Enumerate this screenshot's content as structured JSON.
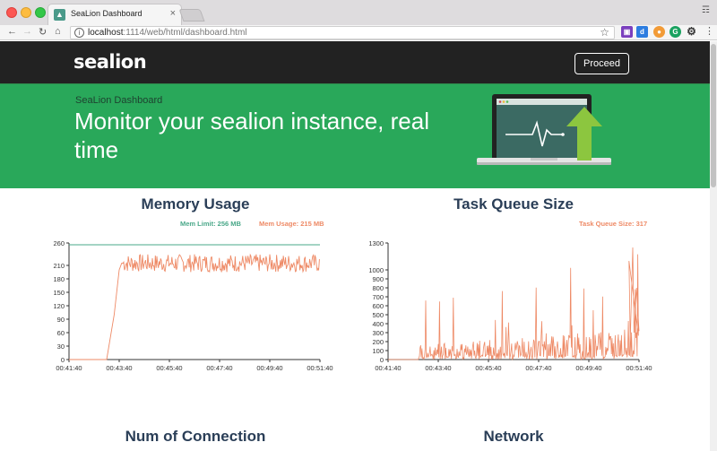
{
  "browser": {
    "tab_title": "SeaLion Dashboard",
    "tab_close": "×",
    "tab_favicon": "🐾",
    "url_host": "localhost",
    "url_path": ":1114/web/html/dashboard.html",
    "icons": [
      "back-icon",
      "forward-icon",
      "reload-icon",
      "home-icon",
      "info-icon",
      "star-icon",
      "menu-icon"
    ]
  },
  "navbar": {
    "logo": "sealion",
    "proceed_label": "Proceed"
  },
  "hero": {
    "subtitle": "SeaLion Dashboard",
    "title": "Monitor your sealion instance, real time"
  },
  "colors": {
    "navbar_bg": "#222222",
    "hero_bg": "#29a85a",
    "limit_series": "#4aa889",
    "usage_series": "#ee8a66",
    "title_text": "#2a3e57"
  },
  "sections": {
    "memory_title": "Memory Usage",
    "queue_title": "Task Queue Size",
    "connection_title": "Num of Connection",
    "network_title": "Network"
  },
  "chart_data": [
    {
      "type": "line",
      "title": "Memory Usage",
      "legend": [
        "Mem Limit: 256 MB",
        "Mem Usage: 215 MB"
      ],
      "x_ticks": [
        "00:41:40",
        "00:43:40",
        "00:45:40",
        "00:47:40",
        "00:49:40",
        "00:51:40"
      ],
      "y_ticks": [
        0,
        30,
        60,
        90,
        120,
        150,
        180,
        210,
        260
      ],
      "ylim": [
        0,
        260
      ],
      "series": [
        {
          "name": "Mem Limit: 256 MB",
          "color": "#4aa889",
          "values": [
            256,
            256
          ]
        },
        {
          "name": "Mem Usage: 215 MB",
          "color": "#ee8a66",
          "x_minutes": [
            0,
            1.2,
            1.5,
            1.8,
            2.0,
            2.1,
            10
          ],
          "values": [
            0,
            0,
            0,
            100,
            200,
            215,
            215
          ],
          "noise_range": [
            195,
            235
          ]
        }
      ]
    },
    {
      "type": "line",
      "title": "Task Queue Size",
      "legend": [
        "Task Queue Size: 317"
      ],
      "x_ticks": [
        "00:41:40",
        "00:43:40",
        "00:45:40",
        "00:47:40",
        "00:49:40",
        "00:51:40"
      ],
      "y_ticks": [
        0,
        100,
        200,
        300,
        400,
        500,
        600,
        700,
        800,
        900,
        1000,
        1300
      ],
      "ylim": [
        0,
        1300
      ],
      "series": [
        {
          "name": "Task Queue Size: 317",
          "color": "#ee8a66",
          "note": "spiky series, zero until ~00:42:55, peaks ~1250 near the end",
          "peaks": [
            790,
            700,
            650,
            800,
            700,
            600,
            850,
            650,
            900,
            800,
            1000,
            1250,
            1200
          ]
        }
      ]
    }
  ]
}
